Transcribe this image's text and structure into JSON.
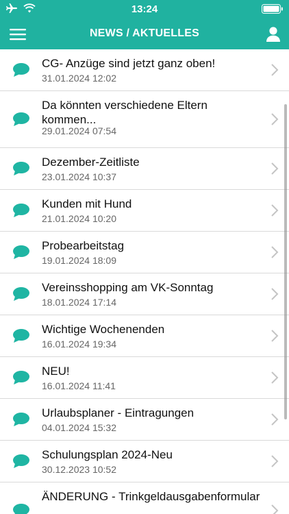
{
  "status": {
    "time": "13:24",
    "icons": {
      "left": [
        "airplane-icon",
        "wifi-icon"
      ],
      "right": "battery-icon"
    }
  },
  "header": {
    "title": "NEWS / AKTUELLES",
    "menu_icon": "hamburger-menu-icon",
    "profile_icon": "person-icon"
  },
  "colors": {
    "accent": "#20b2a0",
    "icon": "#1fb5a3",
    "chevron": "#c4c4c4",
    "divider": "#d9d9d9"
  },
  "news": [
    {
      "title": "CG- Anzüge sind jetzt ganz oben!",
      "date": "31.01.2024 12:02"
    },
    {
      "title": "Da könnten verschiedene Eltern kommen...",
      "date": "29.01.2024 07:54"
    },
    {
      "title": "Dezember-Zeitliste",
      "date": "23.01.2024 10:37"
    },
    {
      "title": "Kunden mit Hund",
      "date": "21.01.2024 10:20"
    },
    {
      "title": "Probearbeitstag",
      "date": "19.01.2024 18:09"
    },
    {
      "title": "Vereinsshopping am VK-Sonntag",
      "date": "18.01.2024 17:14"
    },
    {
      "title": "Wichtige Wochenenden",
      "date": "16.01.2024 19:34"
    },
    {
      "title": "NEU!",
      "date": "16.01.2024 11:41"
    },
    {
      "title": "Urlaubsplaner - Eintragungen",
      "date": "04.01.2024 15:32"
    },
    {
      "title": "Schulungsplan 2024-Neu",
      "date": "30.12.2023 10:52"
    },
    {
      "title": "ÄNDERUNG - Trinkgeldausgabenformular",
      "date": ""
    }
  ]
}
